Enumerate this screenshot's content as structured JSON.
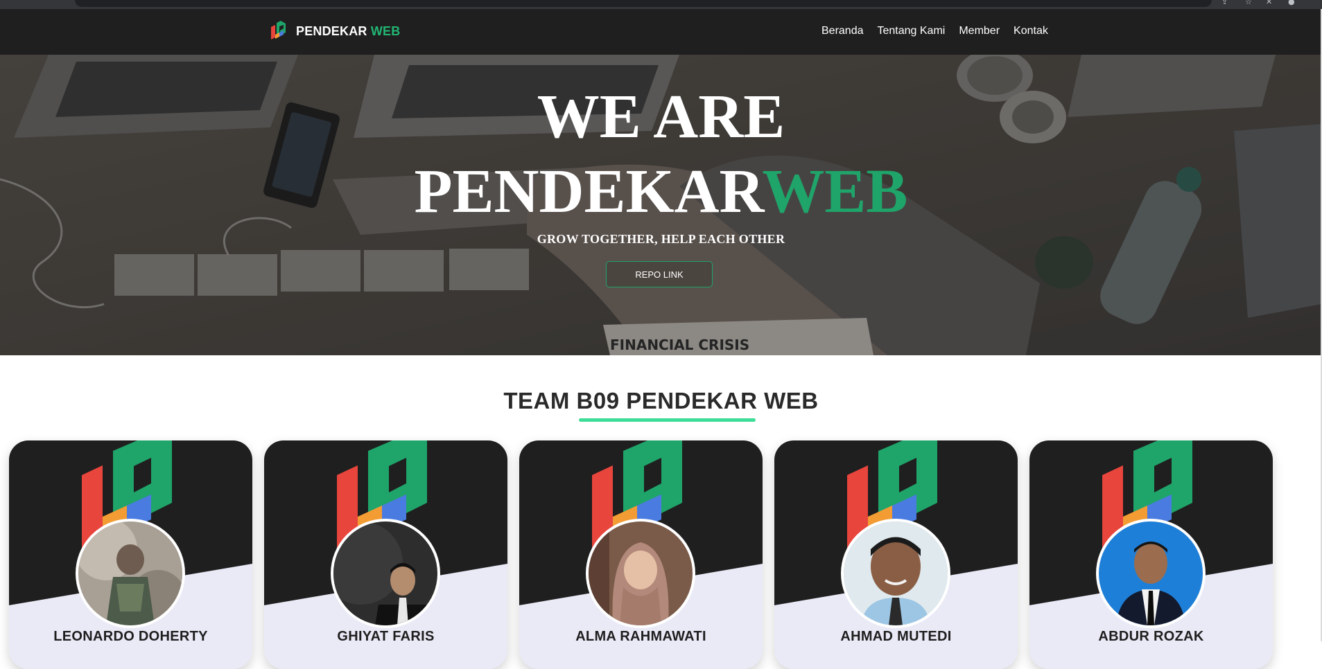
{
  "navbar": {
    "brand": {
      "primary": "PENDEKAR",
      "accent": "WEB"
    },
    "links": [
      "Beranda",
      "Tentang Kami",
      "Member",
      "Kontak"
    ]
  },
  "hero": {
    "title_line1": "WE ARE",
    "title_line2_primary": "PENDEKAR",
    "title_line2_accent": "WEB",
    "subtitle": "GROW TOGETHER, HELP EACH OTHER",
    "button_label": "REPO LINK",
    "background_text": "FINANCIAL CRISIS"
  },
  "team": {
    "title": "TEAM B09 PENDEKAR WEB",
    "members": [
      {
        "name": "LEONARDO DOHERTY"
      },
      {
        "name": "GHIYAT FARIS"
      },
      {
        "name": "ALMA RAHMAWATI"
      },
      {
        "name": "AHMAD MUTEDI"
      },
      {
        "name": "ABDUR ROZAK"
      }
    ]
  },
  "colors": {
    "accent_green": "#1fa46a",
    "underline_green": "#3ddc97",
    "navbar_bg": "#1f1f1f",
    "card_dark": "#1f1f1f",
    "card_light": "#e9eaf6"
  },
  "icons": {
    "brand_logo": "pendekar-web-logo",
    "card_logo": "pendekar-web-logo"
  }
}
